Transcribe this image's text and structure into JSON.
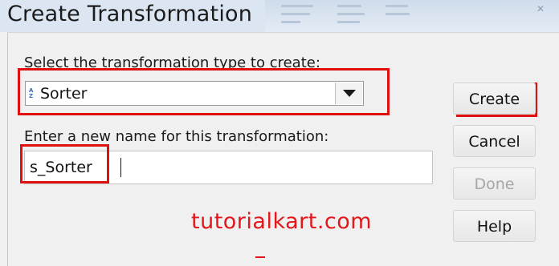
{
  "window": {
    "title": "Create Transformation"
  },
  "form": {
    "type_label": "Select the transformation type to create:",
    "type_value": "Sorter",
    "type_icon_glyph": "A Z",
    "name_label": "Enter a new name for this transformation:",
    "name_value": "s_Sorter"
  },
  "buttons": {
    "create": "Create",
    "cancel": "Cancel",
    "done": "Done",
    "help": "Help"
  },
  "watermark": "tutorialkart.com",
  "colors": {
    "highlight": "#e01010",
    "watermark": "#e3161b",
    "titlebar": "#dbe6f2",
    "dialog_bg": "#f0f0f0"
  },
  "icons": {
    "sort": "sort-az-icon",
    "dropdown": "chevron-down-icon"
  }
}
